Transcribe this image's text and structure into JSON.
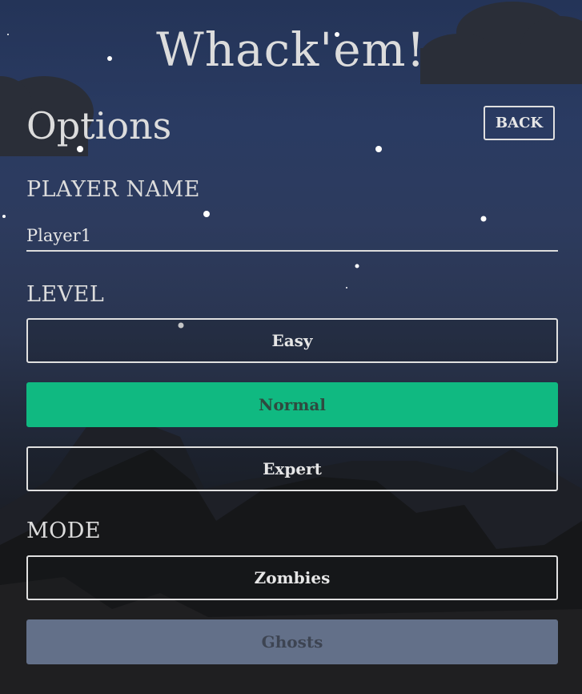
{
  "app": {
    "title": "Whack'em!"
  },
  "page": {
    "title": "Options",
    "back_label": "BACK"
  },
  "player": {
    "label": "PLAYER NAME",
    "value": "Player1"
  },
  "level": {
    "label": "LEVEL",
    "options": [
      "Easy",
      "Normal",
      "Expert"
    ],
    "selected": "Normal"
  },
  "mode": {
    "label": "MODE",
    "options": [
      "Zombies",
      "Ghosts"
    ],
    "selected": "Ghosts"
  },
  "colors": {
    "level_selected": "#10b981",
    "mode_selected": "#637089",
    "sky_top": "#243458",
    "ground": "#181a1f"
  }
}
